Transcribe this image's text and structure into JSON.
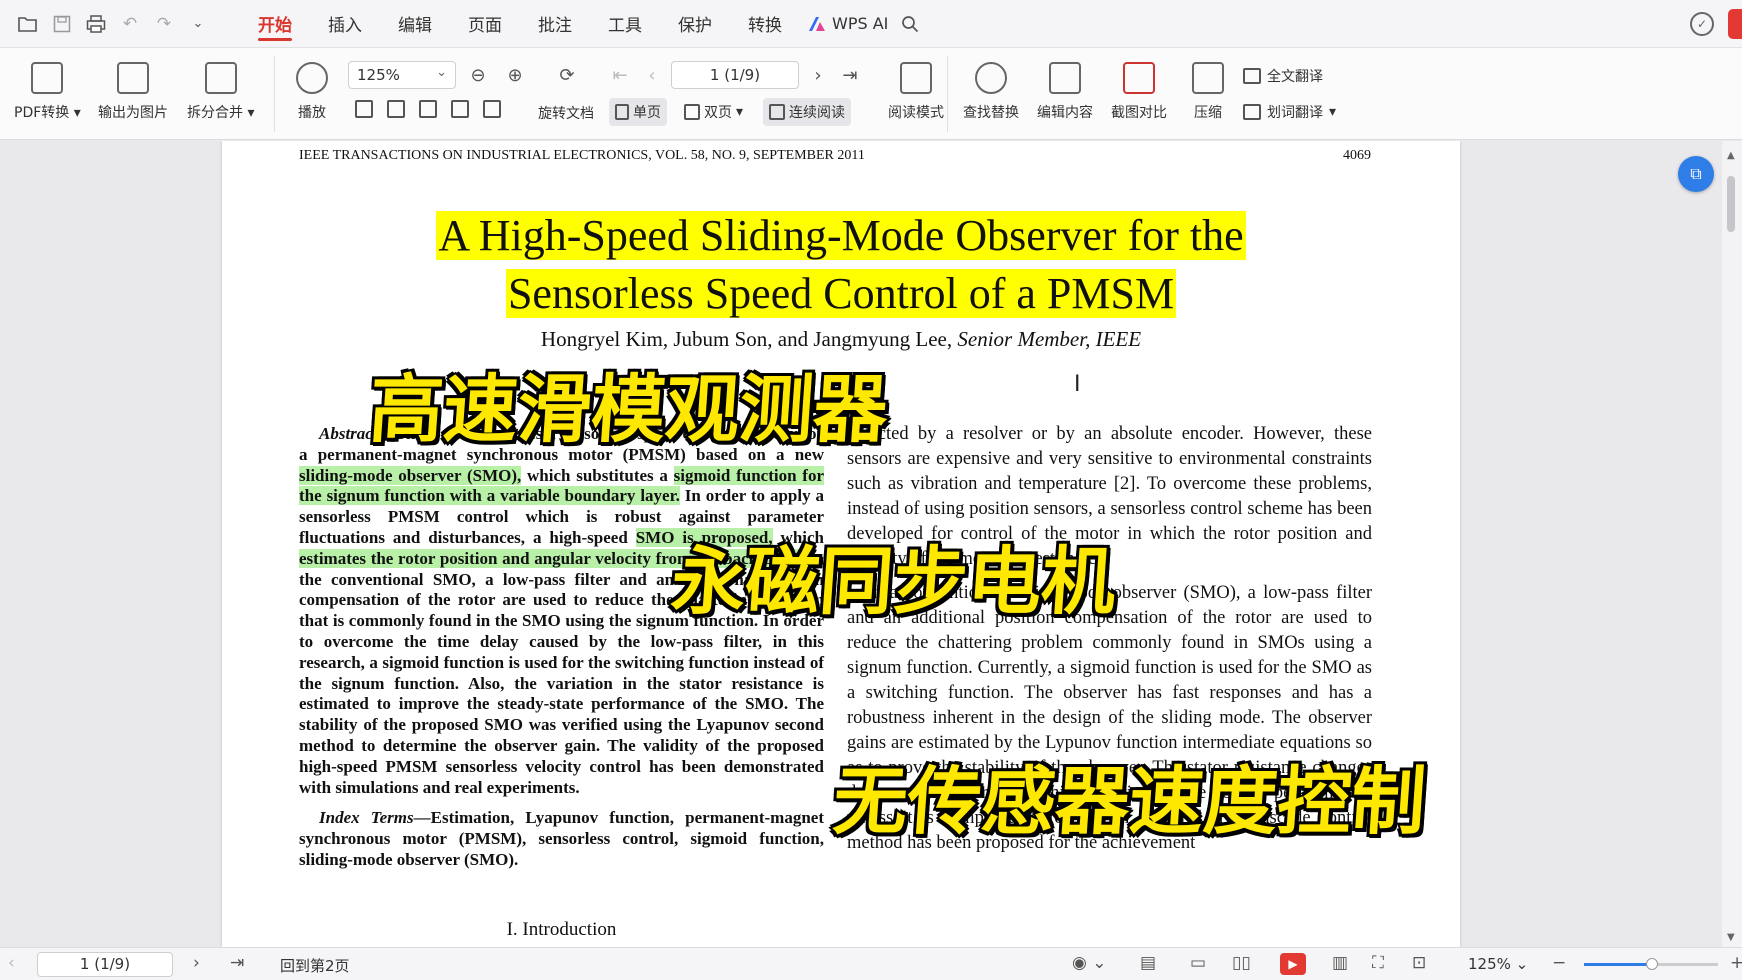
{
  "titlebar": {
    "tabs": [
      "开始",
      "插入",
      "编辑",
      "页面",
      "批注",
      "工具",
      "保护",
      "转换"
    ],
    "active_tab": "开始",
    "wps_ai": "WPS AI"
  },
  "ribbon": {
    "pdf_convert": "PDF转换",
    "export_image": "输出为图片",
    "split_merge": "拆分合并",
    "play": "播放",
    "zoom": "125%",
    "rotate": "旋转文档",
    "single_page": "单页",
    "double_page": "双页",
    "continuous": "连续阅读",
    "page_indicator": "1 (1/9)",
    "read_mode": "阅读模式",
    "find_replace": "查找替换",
    "edit_content": "编辑内容",
    "screenshot_compare": "截图对比",
    "compress": "压缩",
    "full_translate": "全文翻译",
    "word_translate": "划词翻译"
  },
  "document": {
    "running_head": "IEEE TRANSACTIONS ON INDUSTRIAL ELECTRONICS, VOL. 58, NO. 9, SEPTEMBER 2011",
    "page_number": "4069",
    "title_line1": "A High-Speed Sliding-Mode Observer for the",
    "title_line2": "Sensorless Speed Control of a PMSM",
    "authors": "Hongryel Kim, Jubum Son, and Jangmyung Lee,",
    "authors_suffix": "Senior Member, IEEE",
    "abstract_label": "Abstract",
    "abstract_a": "—This paper proposes a sensorless speed control strategy for a permanent-magnet synchronous motor (PMSM) based on a new ",
    "abstract_hl1": "sliding-mode observer (SMO),",
    "abstract_b": " which substitutes a ",
    "abstract_hl2": "sigmoid function for the signum function with a variable boundary layer.",
    "abstract_c": " In order to apply a sensorless PMSM control which is robust against parameter fluctuations and disturbances, a high-speed ",
    "abstract_hl3": "SMO is proposed,",
    "abstract_d": " which ",
    "abstract_hl4": "estimates the rotor position and angular velocity from the back EMF.",
    "abstract_e": " In the conventional SMO, a low-pass filter and an additional position compensation of the rotor are used to reduce the chattering problem that is commonly found in the SMO using the signum function. In order to overcome the time delay caused by the low-pass filter, in this research, a sigmoid function is used for the switching function instead of the signum function. Also, the variation in the stator resistance is estimated to improve the steady-state performance of the SMO. The stability of the proposed SMO was verified using the Lyapunov second method to determine the observer gain. The validity of the proposed high-speed PMSM sensorless velocity control has been demonstrated with simulations and real experiments.",
    "index_label": "Index Terms",
    "index_text": "—Estimation, Lyapunov function, permanent-magnet synchronous motor (PMSM), sensorless control, sigmoid function, sliding-mode observer (SMO).",
    "intro_heading": "I. Introduction",
    "right_p1": "detected by a resolver or by an absolute encoder. However, these sensors are expensive and very sensitive to environmental constraints such as vibration and temperature [2]. To overcome these problems, instead of using position sensors, a sensorless control scheme has been developed for control of the motor in which the rotor position and velocity of the motor are estimated.",
    "right_p2": "In a conventional sliding-mode observer (SMO), a low-pass filter and an additional position compensation of the rotor are used to reduce the chattering problem commonly found in SMOs using a signum function. Currently, a sigmoid function is used for the SMO as a switching function. The observer has fast responses and has a robustness inherent in the design of the sliding mode. The observer gains are estimated by the Lypunov function intermediate equations so as to prove the stability of the observer. The stator resistance changes during motor operation, which deteriorates the control performance, unless it is compensated for in real time [8]. The cascade control method has been proposed for the achievement"
  },
  "overlays": {
    "caption1": "高速滑模观测器",
    "caption2": "永磁同步电机",
    "caption3": "无传感器速度控制"
  },
  "statusbar": {
    "page": "1 (1/9)",
    "back_to_page": "回到第2页",
    "zoom": "125%"
  }
}
